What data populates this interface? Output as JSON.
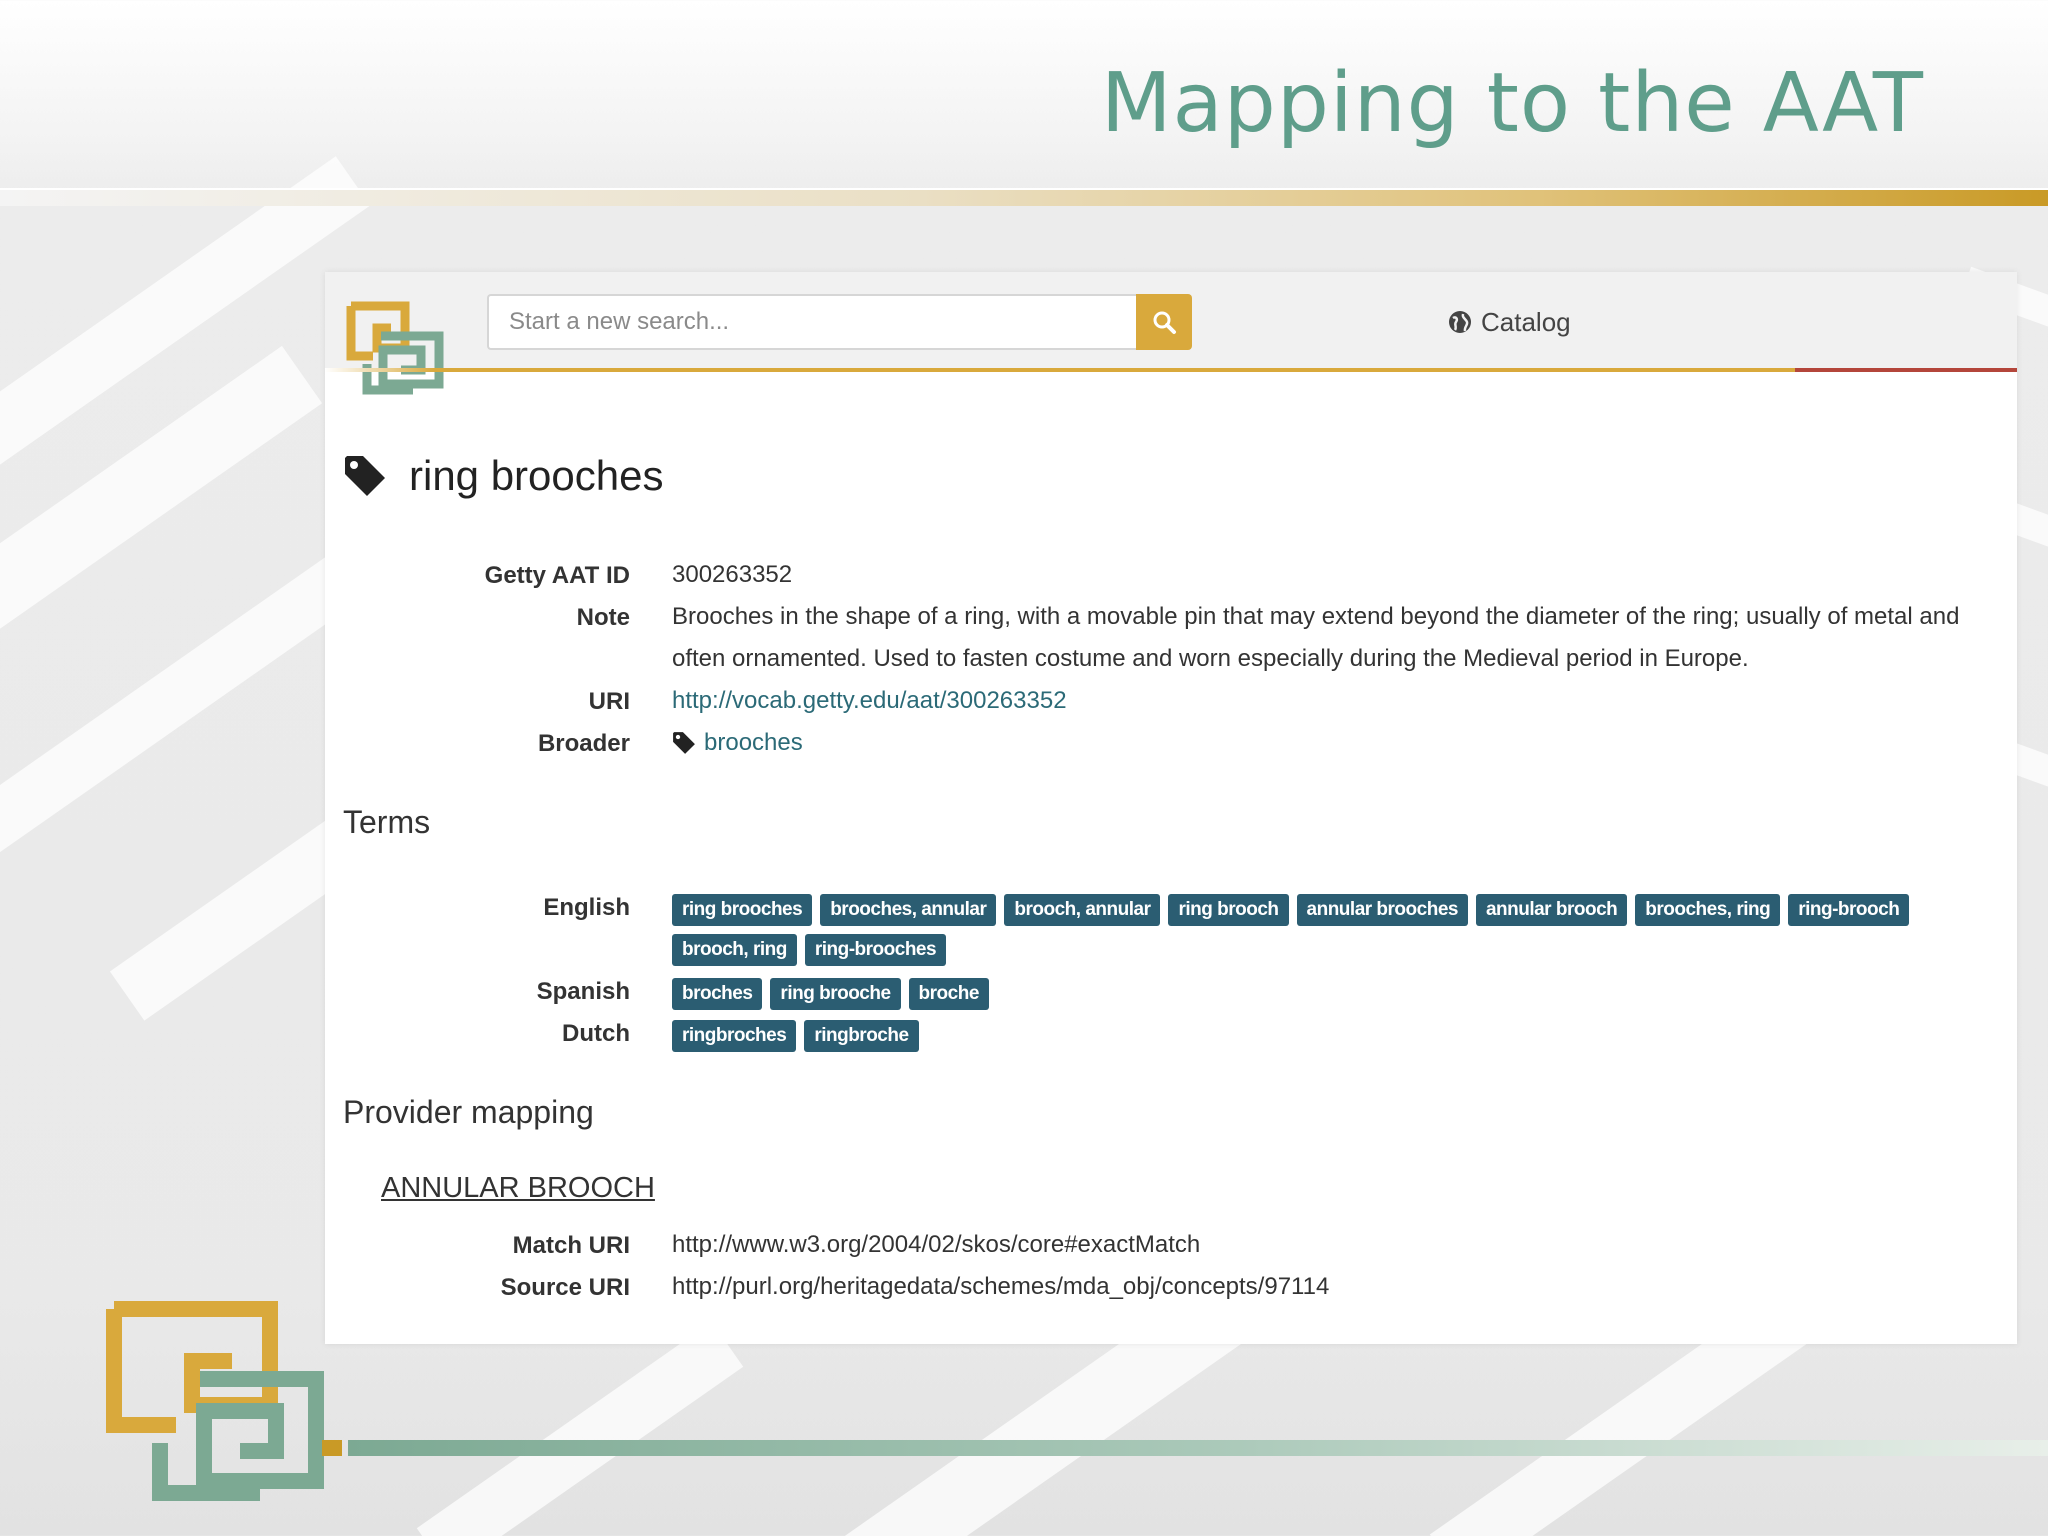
{
  "slide": {
    "title": "Mapping to the AAT"
  },
  "navbar": {
    "search_placeholder": "Start a new search...",
    "search_button_icon": "search-icon",
    "catalog_label": "Catalog",
    "catalog_icon": "globe-icon"
  },
  "concept": {
    "icon": "tag-icon",
    "title": "ring brooches",
    "fields": {
      "aat_id_label": "Getty AAT ID",
      "aat_id_value": "300263352",
      "note_label": "Note",
      "note_value": "Brooches in the shape of a ring, with a movable pin that may extend beyond the diameter of the ring; usually of metal and often ornamented. Used to fasten costume and worn especially during the Medieval period in Europe.",
      "uri_label": "URI",
      "uri_value": "http://vocab.getty.edu/aat/300263352",
      "broader_label": "Broader",
      "broader_value": "brooches"
    }
  },
  "terms": {
    "heading": "Terms",
    "languages": [
      {
        "label": "English",
        "tags": [
          "ring brooches",
          "brooches, annular",
          "brooch, annular",
          "ring brooch",
          "annular brooches",
          "annular brooch",
          "brooches, ring",
          "ring-brooch",
          "brooch, ring",
          "ring-brooches"
        ]
      },
      {
        "label": "Spanish",
        "tags": [
          "broches",
          "ring brooche",
          "broche"
        ]
      },
      {
        "label": "Dutch",
        "tags": [
          "ringbroches",
          "ringbroche"
        ]
      }
    ]
  },
  "provider_mapping": {
    "heading": "Provider mapping",
    "entry_label": "ANNULAR BROOCH",
    "match_uri_label": "Match URI",
    "match_uri_value": "http://www.w3.org/2004/02/skos/core#exactMatch",
    "source_uri_label": "Source URI",
    "source_uri_value": "http://purl.org/heritagedata/schemes/mda_obj/concepts/97114"
  },
  "colors": {
    "title_green": "#5f9e8b",
    "gold": "#d9a93c",
    "tag_blue": "#2b5d72",
    "link_teal": "#2b6a77",
    "accent_red": "#b4463b"
  }
}
